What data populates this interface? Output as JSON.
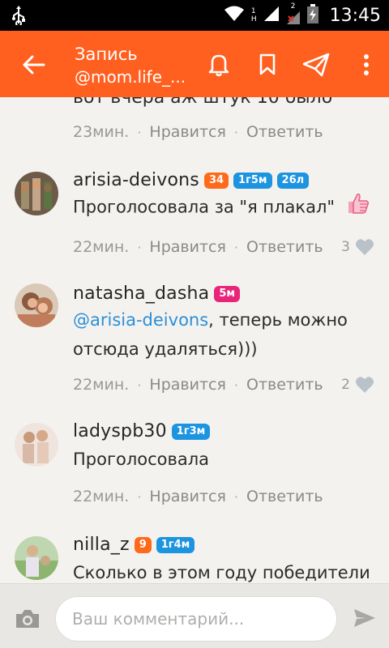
{
  "status_bar": {
    "time": "13:45",
    "sim1_label": "H",
    "sim1_num": "1",
    "sim2_num": "2"
  },
  "header": {
    "title": "Запись",
    "subtitle": "@mom.life_...",
    "accent_color": "#ff5f1f"
  },
  "feed": {
    "partial_comment": {
      "text": "вот вчера аж штук 10 было",
      "time": "23мин.",
      "like_label": "Нравится",
      "reply_label": "Ответить"
    },
    "comments": [
      {
        "username": "arisia-deivons",
        "badges": [
          {
            "text": "34",
            "color": "orange"
          },
          {
            "text": "1г5м",
            "color": "blue"
          },
          {
            "text": "26л",
            "color": "blue"
          }
        ],
        "text": "Проголосовала за \"я плакал\"",
        "has_thumb_emoji": true,
        "time": "22мин.",
        "like_label": "Нравится",
        "reply_label": "Ответить",
        "likes": "3"
      },
      {
        "username": "natasha_dasha",
        "badges": [
          {
            "text": "5м",
            "color": "pink"
          }
        ],
        "mention": "@arisia-deivons",
        "text_after_mention": ", теперь можно",
        "text_line2": "отсюда удаляться)))",
        "time": "22мин.",
        "like_label": "Нравится",
        "reply_label": "Ответить",
        "likes": "2"
      },
      {
        "username": "ladyspb30",
        "badges": [
          {
            "text": "1г3м",
            "color": "blue"
          }
        ],
        "text": "Проголосовала",
        "time": "22мин.",
        "like_label": "Нравится",
        "reply_label": "Ответить"
      },
      {
        "username": "nilla_z",
        "badges": [
          {
            "text": "9",
            "color": "orange"
          },
          {
            "text": "1г4м",
            "color": "blue"
          }
        ],
        "text": "Сколько в этом году победители"
      }
    ],
    "dot_separator": "·"
  },
  "composer": {
    "placeholder": "Ваш комментарий..."
  }
}
